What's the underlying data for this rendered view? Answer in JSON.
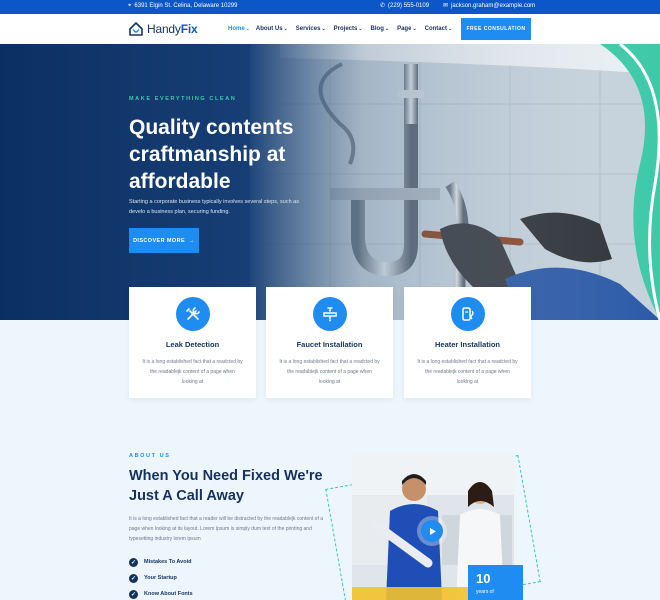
{
  "topbar": {
    "address": "6391 Elgin St. Celina, Delaware 10299",
    "phone": "(229) 555-0109",
    "email": "jackson.graham@example.com"
  },
  "brand": {
    "name_prefix": "Handy",
    "name_suffix": "Fix"
  },
  "nav": {
    "items": [
      {
        "label": "Home",
        "dropdown": true,
        "active": true
      },
      {
        "label": "About Us",
        "dropdown": true
      },
      {
        "label": "Services",
        "dropdown": true
      },
      {
        "label": "Projects",
        "dropdown": true
      },
      {
        "label": "Blog",
        "dropdown": true
      },
      {
        "label": "Page",
        "dropdown": true
      },
      {
        "label": "Contact",
        "dropdown": true
      }
    ],
    "cta": "FREE CONSULATION"
  },
  "hero": {
    "kicker": "MAKE EVERYTHING CLEAN",
    "title": "Quality contents craftmanship at affordable",
    "subtitle": "Starting a corporate business typically involves several steps, such as develo a business plan, securing funding.",
    "button": "DISCOVER MORE"
  },
  "features": [
    {
      "title": "Leak Detection",
      "text": "It is a long established fact that a readcted by the readablejk content of a page when looking at",
      "icon": "wrench-screwdriver-icon"
    },
    {
      "title": "Faucet Installation",
      "text": "It is a long established fact that a readcted by the readablejk content of a page when looking at",
      "icon": "faucet-icon"
    },
    {
      "title": "Heater Installation",
      "text": "It is a long established fact that a readcted by the readablejk content of a page when looking at",
      "icon": "heater-icon"
    }
  ],
  "about": {
    "kicker": "ABOUT US",
    "title": "When You Need Fixed We're Just A Call Away",
    "text": "It is a long established fact that a reader will be distracted by the readablejk content of a page when looking at its layout. Lorem Ipsum is simply dum text of the printing and typesetting industry lorem ipsum",
    "checks": [
      "Mistakes To Avoid",
      "Your Startup",
      "Know About Fonts"
    ],
    "years_number": "10",
    "years_label": "years of"
  },
  "colors": {
    "primary": "#1e8cf0",
    "dark_navy": "#16325c",
    "accent_green": "#3ec9a8",
    "topbar": "#0b56c8"
  }
}
